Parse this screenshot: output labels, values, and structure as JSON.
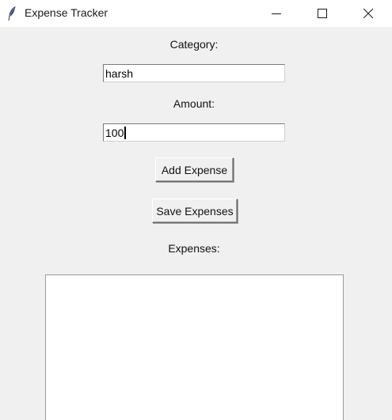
{
  "window": {
    "title": "Expense Tracker",
    "icon": "feather-icon",
    "controls": [
      "minimize-icon",
      "maximize-icon",
      "close-icon"
    ]
  },
  "form": {
    "category_label": "Category:",
    "category_value": "harsh",
    "amount_label": "Amount:",
    "amount_value": "100",
    "add_button": "Add Expense",
    "save_button": "Save Expenses",
    "expenses_label": "Expenses:",
    "expenses_items": []
  },
  "colors": {
    "background": "#f0f0f0",
    "titlebar": "#ffffff"
  }
}
